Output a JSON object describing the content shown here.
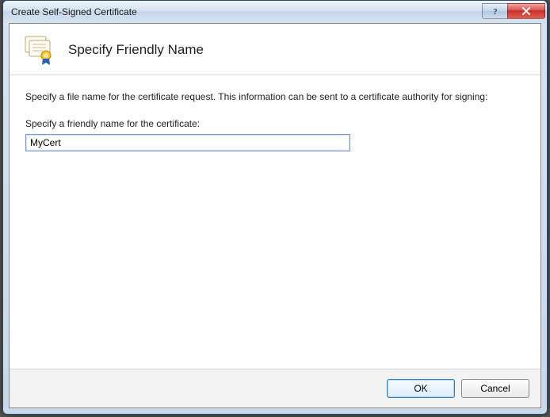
{
  "window": {
    "title": "Create Self-Signed Certificate"
  },
  "header": {
    "title": "Specify Friendly Name"
  },
  "body": {
    "instruction": "Specify a file name for the certificate request.  This information can be sent to a certificate authority for signing:",
    "field_label": "Specify a friendly name for the certificate:",
    "friendly_name_value": "MyCert"
  },
  "buttons": {
    "ok": "OK",
    "cancel": "Cancel"
  }
}
